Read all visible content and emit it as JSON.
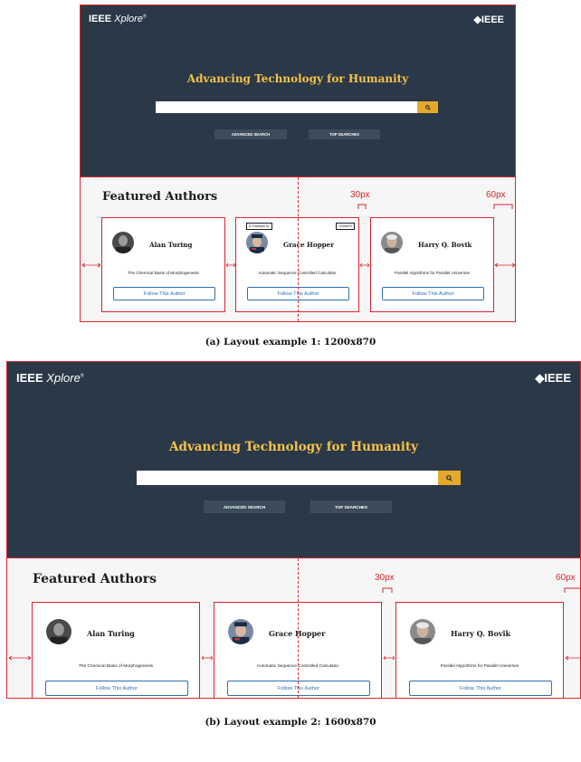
{
  "site": {
    "brand_name": "IEEE",
    "brand_product": "Xplore",
    "brand_mark": "®",
    "logo_text": "◆IEEE",
    "hero_title": "Advancing Technology for Humanity",
    "search_icon": "magnifier-icon",
    "advanced_search": "ADVANCED SEARCH",
    "top_searches": "TOP SEARCHES",
    "featured_title": "Featured Authors",
    "follow_label": "Follow This Author"
  },
  "authors": [
    {
      "name": "Alan Turing",
      "paper": "The Chemical Basis of Morphogenesis"
    },
    {
      "name": "Grace Hopper",
      "paper": "Automatic Sequence Controlled Calculator"
    },
    {
      "name": "Harry Q. Bovik",
      "paper": "Parallel Algorithms for Parallel Universes"
    }
  ],
  "annotations": {
    "gap_label": "30px",
    "margin_label": "60px",
    "note_left": "A: Example #1",
    "note_right": "1200x870"
  },
  "captions": {
    "layout1": "(a) Layout example 1: 1200x870",
    "layout2": "(b) Layout example 2: 1600x870"
  },
  "colors": {
    "hero_bg": "#2b3847",
    "title_gold": "#f5c24a",
    "search_button": "#e3a92b",
    "annotation_red": "#d9262b",
    "follow_blue": "#2f6fb6"
  }
}
